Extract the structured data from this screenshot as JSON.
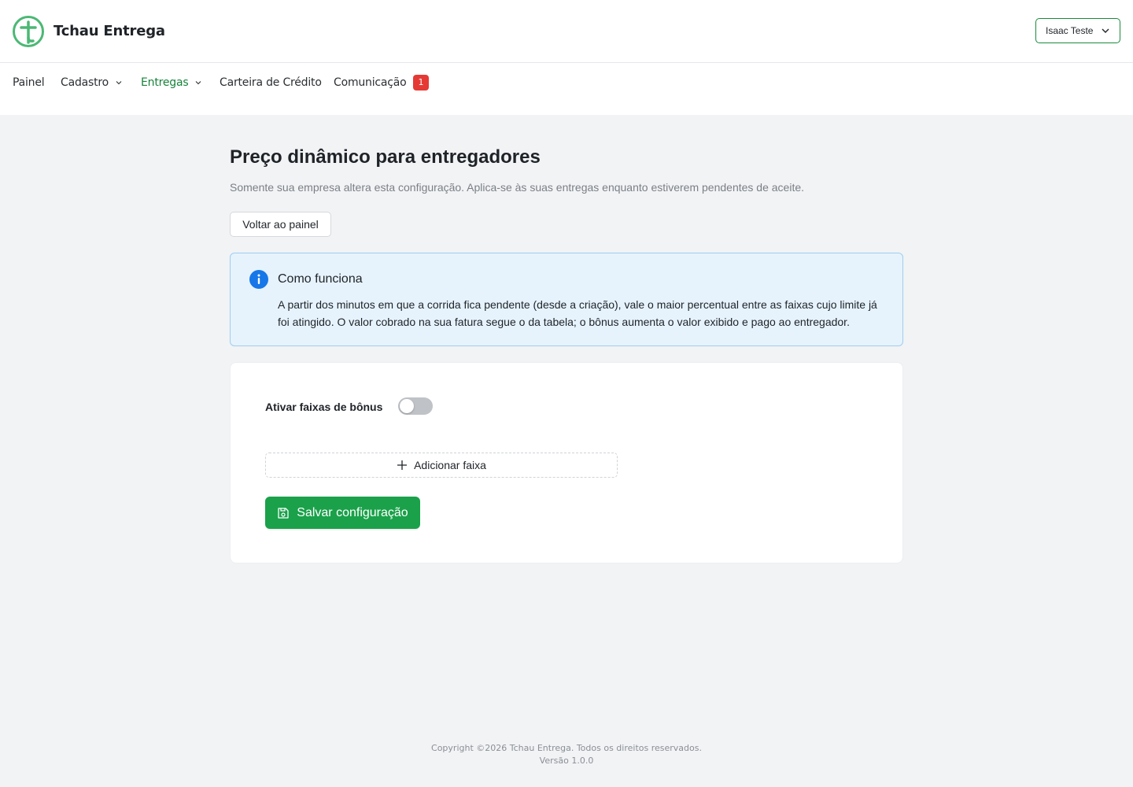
{
  "header": {
    "brand": "Tchau Entrega",
    "user_name": "Isaac Teste",
    "logo_icon": "cross-circle-logo",
    "brand_color": "#4cb875"
  },
  "nav": {
    "items": [
      {
        "label": "Painel",
        "has_dropdown": false,
        "active": false
      },
      {
        "label": "Cadastro",
        "has_dropdown": true,
        "active": false
      },
      {
        "label": "Entregas",
        "has_dropdown": true,
        "active": true
      },
      {
        "label": "Carteira de Crédito",
        "has_dropdown": false,
        "active": false
      },
      {
        "label": "Comunicação",
        "has_dropdown": false,
        "active": false,
        "badge": "1"
      }
    ],
    "active_color": "#17833a",
    "badge_color": "#e53935"
  },
  "main": {
    "title": "Preço dinâmico para entregadores",
    "subtitle": "Somente sua empresa altera esta configuração. Aplica-se às suas entregas enquanto estiverem pendentes de aceite.",
    "back_label": "Voltar ao painel"
  },
  "info": {
    "icon": "info-icon",
    "title": "Como funciona",
    "text": "A partir dos minutos em que a corrida fica pendente (desde a criação), vale o maior percentual entre as faixas cujo limite já foi atingido. O valor cobrado na sua fatura segue o da tabela; o bônus aumenta o valor exibido e pago ao entregador.",
    "bg_color": "#e6f3fd",
    "border_color": "#9fcdf0"
  },
  "settings": {
    "toggle_label": "Ativar faixas de bônus",
    "toggle_on": false,
    "add_label": "Adicionar faixa",
    "save_label": "Salvar configuração",
    "save_color": "#1aa14a"
  },
  "footer": {
    "copyright": "Copyright ©2026 Tchau Entrega. Todos os direitos reservados.",
    "version": "Versão 1.0.0"
  }
}
